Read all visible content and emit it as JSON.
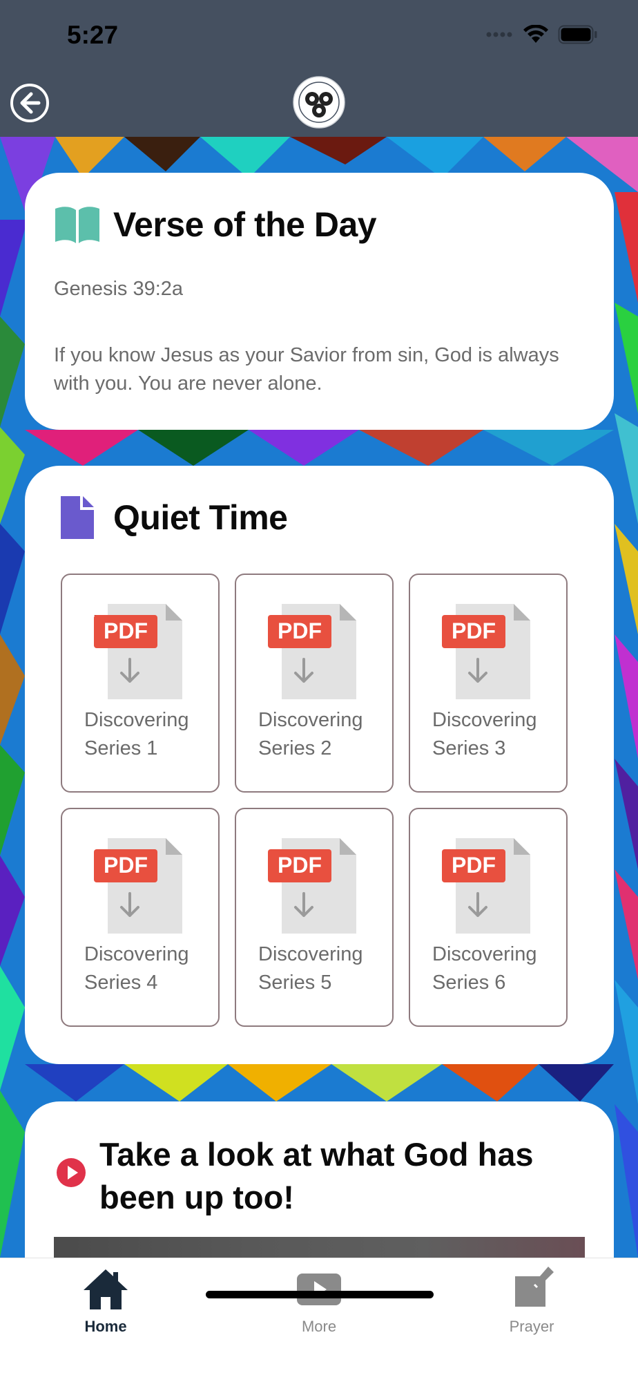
{
  "status": {
    "time": "5:27"
  },
  "nav": {
    "logo": "church-seal-logo",
    "back_icon": "back-arrow-icon"
  },
  "verse": {
    "title": "Verse of the Day",
    "icon": "open-book-icon",
    "reference": "Genesis 39:2a",
    "text": "If you know Jesus as your Savior from sin, God is always with you. You are never alone."
  },
  "quiet_time": {
    "title": "Quiet Time",
    "icon": "document-icon",
    "items": [
      {
        "badge": "PDF",
        "line1": "Discovering",
        "line2": "Series 1"
      },
      {
        "badge": "PDF",
        "line1": "Discovering",
        "line2": "Series 2"
      },
      {
        "badge": "PDF",
        "line1": "Discovering",
        "line2": "Series 3"
      },
      {
        "badge": "PDF",
        "line1": "Discovering",
        "line2": "Series 4"
      },
      {
        "badge": "PDF",
        "line1": "Discovering",
        "line2": "Series 5"
      },
      {
        "badge": "PDF",
        "line1": "Discovering",
        "line2": "Series 6"
      }
    ]
  },
  "video": {
    "title": "Take a look at what God has been up too!",
    "icon": "play-circle-icon"
  },
  "tabs": {
    "home": "Home",
    "more": "More",
    "prayer": "Prayer"
  },
  "colors": {
    "header": "#455060",
    "verse_icon": "#5cbfab",
    "quiet_icon": "#6a5acd",
    "pdf_badge": "#e8503f",
    "play_icon": "#e0324a",
    "tab_active": "#1a2a3a",
    "tab_inactive": "#8a8a8a"
  }
}
